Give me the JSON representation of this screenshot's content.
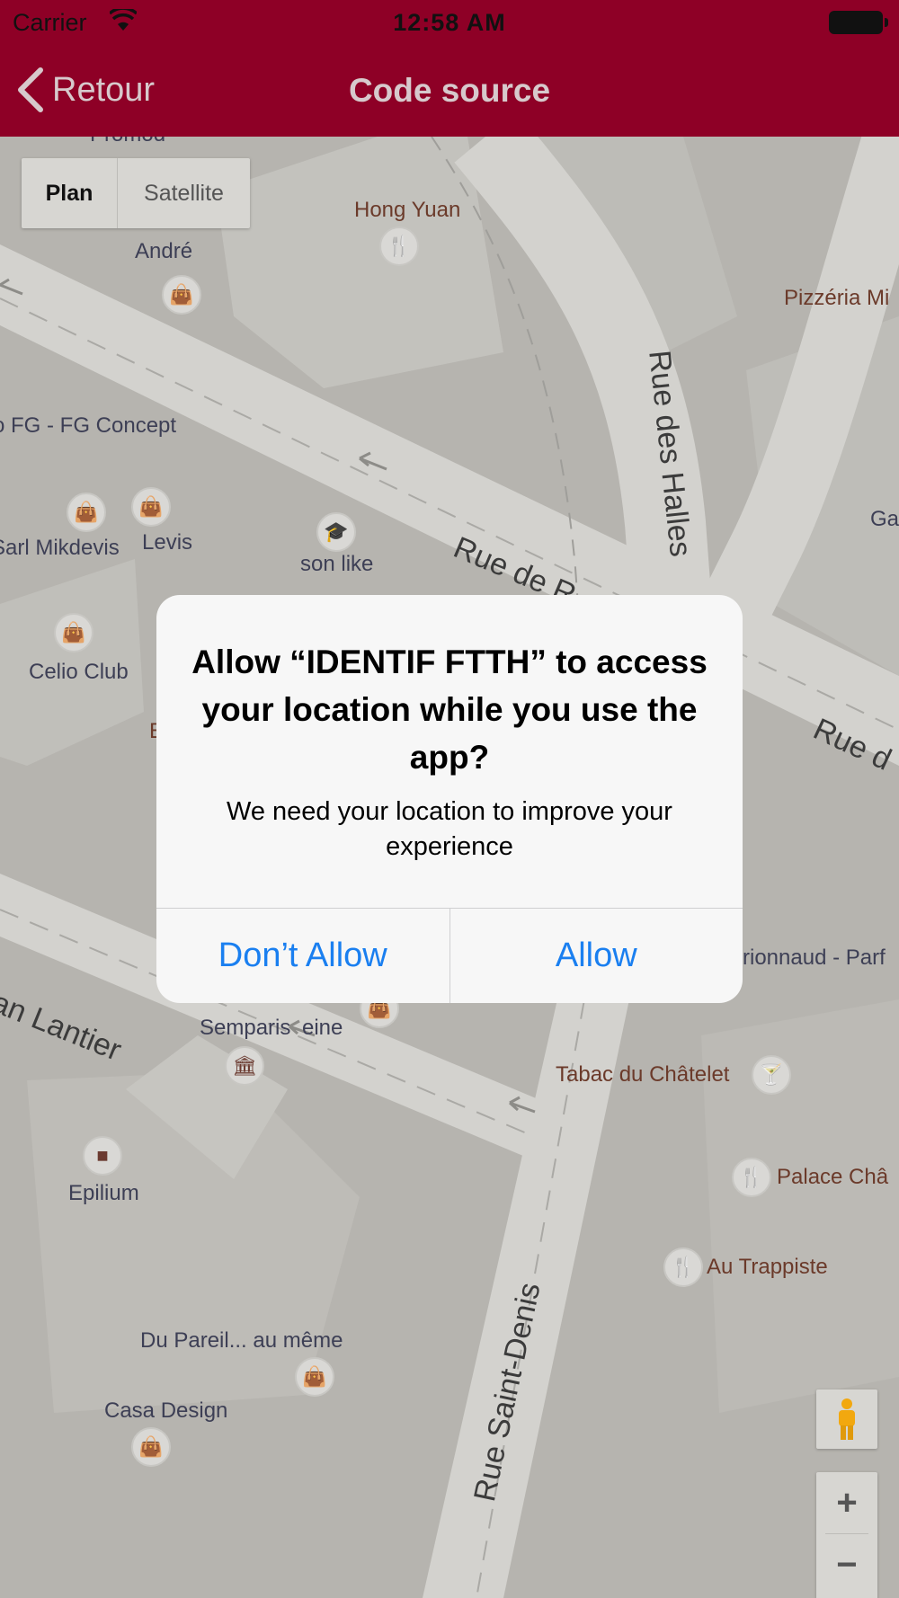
{
  "status_bar": {
    "carrier": "Carrier",
    "time": "12:58 AM"
  },
  "nav": {
    "back_label": "Retour",
    "title": "Code source"
  },
  "map": {
    "map_type": {
      "plan": "Plan",
      "satellite": "Satellite"
    },
    "streets": {
      "rue_des_halles": "Rue des Halles",
      "rue_de": "Rue de R",
      "rue_right": "Rue d",
      "lantier": "an Lantier",
      "saint_denis": "Rue Saint-Denis"
    },
    "places": {
      "top_cut": "Promod",
      "hong_yuan": "Hong Yuan",
      "andre": "André",
      "pizzeria": "Pizzéria Mi",
      "fg_concept": "o FG - FG Concept",
      "ga": "Ga",
      "sarl_mikdevis": "Sarl Mikdevis",
      "levis": "Levis",
      "son_like": "son like",
      "celio": "Celio Club",
      "e_cut": "E",
      "nocibe": "rionnaud - Parf",
      "semparis": "Semparis",
      "semparis_eine": "eine",
      "tabac": "Tabac du Châtelet",
      "palace": "Palace Châ",
      "epilium": "Epilium",
      "au_trappiste": "Au Trappiste",
      "du_pareil": "Du Pareil... au même",
      "casa_design": "Casa Design"
    },
    "zoom_in": "+",
    "zoom_out": "−"
  },
  "alert": {
    "title": "Allow “IDENTIF FTTH” to access your location while you use the app?",
    "message": "We need your location to improve your experience",
    "deny_label": "Don’t Allow",
    "allow_label": "Allow"
  },
  "colors": {
    "nav_bg": "#8e0026",
    "link_blue": "#1a7ff0",
    "shop_icon": "#4d57a7",
    "food_icon": "#c56a12"
  }
}
